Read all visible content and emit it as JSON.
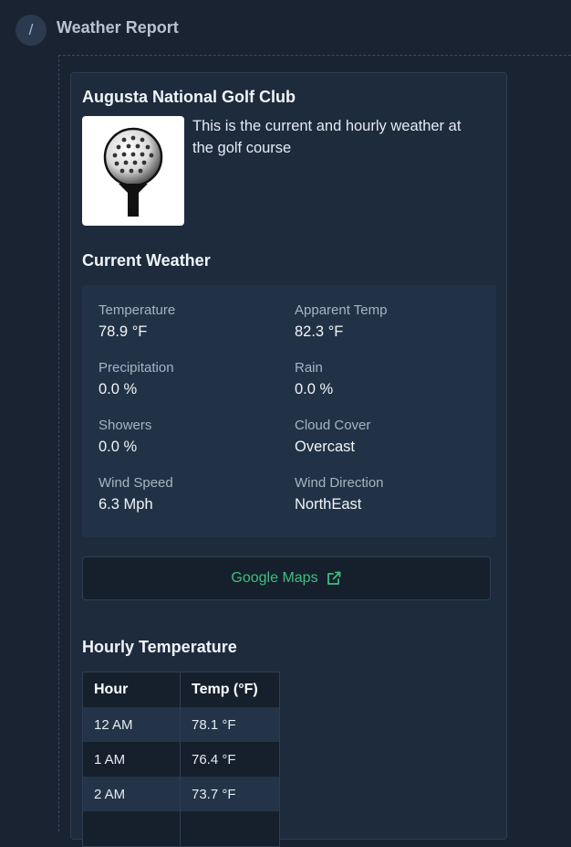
{
  "header": {
    "title": "Weather Report",
    "badge_glyph": "/"
  },
  "course": {
    "name": "Augusta National Golf Club",
    "description": "This is the current and hourly weather at the golf course",
    "image_icon": "golf-ball-on-tee-icon"
  },
  "current": {
    "title": "Current Weather",
    "metrics": [
      {
        "label": "Temperature",
        "value": "78.9 °F"
      },
      {
        "label": "Apparent Temp",
        "value": "82.3 °F"
      },
      {
        "label": "Precipitation",
        "value": "0.0 %"
      },
      {
        "label": "Rain",
        "value": "0.0 %"
      },
      {
        "label": "Showers",
        "value": "0.0 %"
      },
      {
        "label": "Cloud Cover",
        "value": "Overcast"
      },
      {
        "label": "Wind Speed",
        "value": "6.3 Mph"
      },
      {
        "label": "Wind Direction",
        "value": "NorthEast"
      }
    ]
  },
  "maps": {
    "label": "Google Maps",
    "icon": "external-link-icon",
    "color": "#3fbf7f"
  },
  "hourly": {
    "title": "Hourly Temperature",
    "columns": [
      "Hour",
      "Temp (°F)"
    ],
    "rows": [
      {
        "hour": "12 AM",
        "temp": "78.1 °F"
      },
      {
        "hour": "1 AM",
        "temp": "76.4 °F"
      },
      {
        "hour": "2 AM",
        "temp": "73.7 °F"
      },
      {
        "hour": "",
        "temp": ""
      }
    ]
  }
}
